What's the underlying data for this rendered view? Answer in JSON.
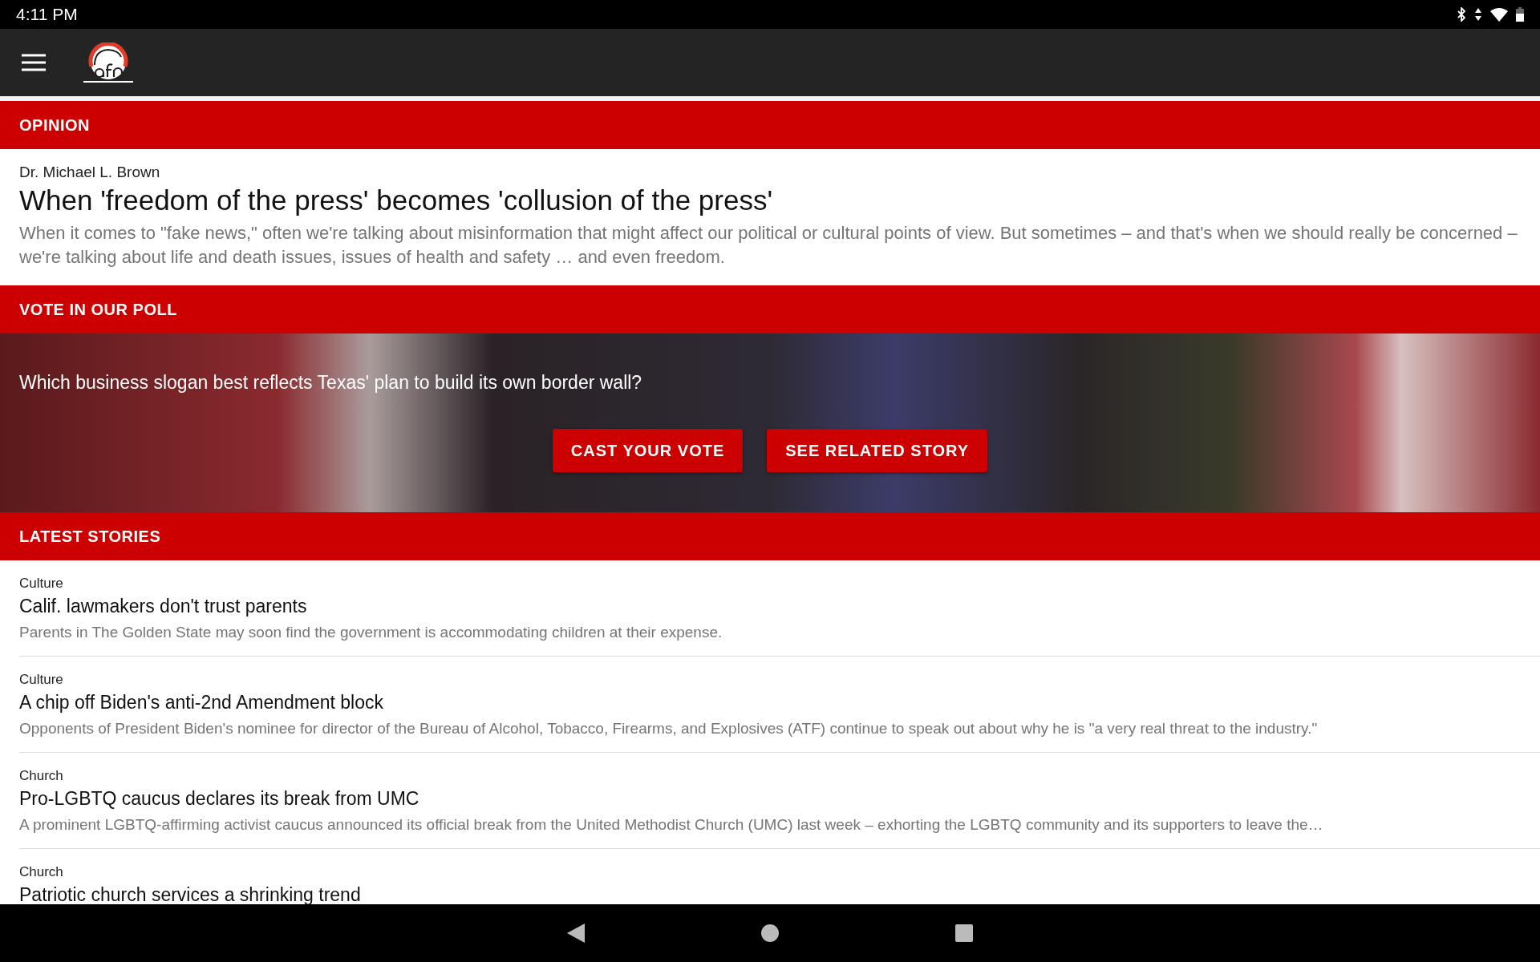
{
  "status_bar": {
    "time": "4:11 PM"
  },
  "opinion": {
    "heading": "OPINION",
    "author": "Dr. Michael L. Brown",
    "title": "When 'freedom of the press' becomes 'collusion of the press'",
    "summary": "When it comes to \"fake news,\" often we're talking about misinformation that might affect our political or cultural points of view. But sometimes – and that's when we should really be concerned – we're talking about life and death issues, issues of health and safety … and even freedom."
  },
  "poll": {
    "heading": "VOTE IN OUR POLL",
    "question": "Which business slogan best reflects Texas' plan to build its own border wall?",
    "buttons": [
      "CAST YOUR VOTE",
      "SEE RELATED STORY"
    ]
  },
  "latest": {
    "heading": "LATEST STORIES",
    "stories": [
      {
        "category": "Culture",
        "title": "Calif. lawmakers don't trust parents",
        "summary": "Parents in The Golden State may soon find the government is accommodating children at their expense."
      },
      {
        "category": "Culture",
        "title": "A chip off Biden's anti-2nd Amendment block",
        "summary": "Opponents of President Biden's nominee for director of the Bureau of Alcohol, Tobacco, Firearms, and Explosives (ATF) continue to speak out about why he is \"a very real threat to the industry.\""
      },
      {
        "category": "Church",
        "title": "Pro-LGBTQ caucus declares its break from UMC",
        "summary": "A prominent LGBTQ-affirming activist caucus announced its official break from the United Methodist Church (UMC) last week – exhorting the LGBTQ community and its supporters to leave the…"
      },
      {
        "category": "Church",
        "title": "Patriotic church services a shrinking trend"
      }
    ]
  }
}
